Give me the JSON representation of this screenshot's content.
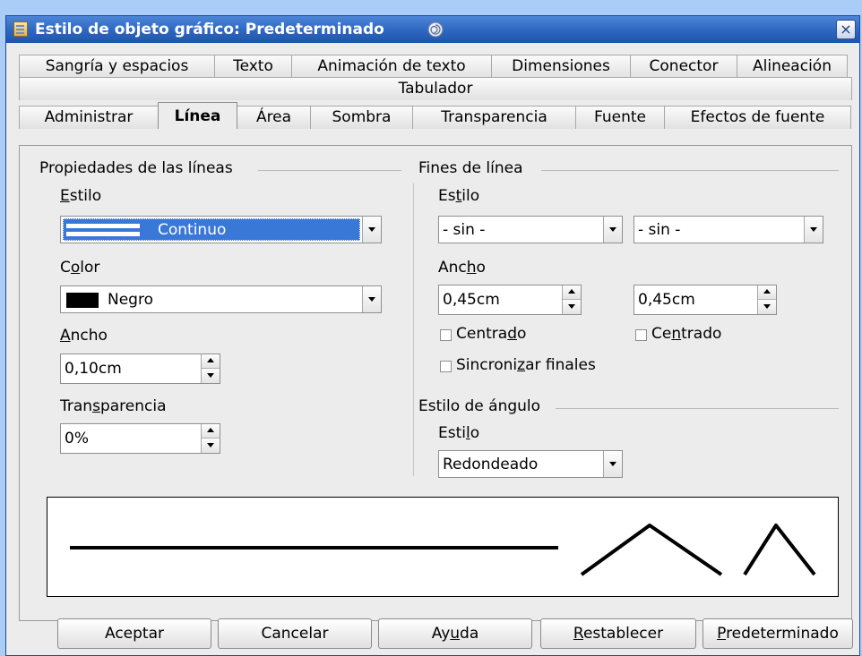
{
  "window": {
    "title": "Estilo de objeto gráfico: Predeterminado",
    "close_glyph": "×"
  },
  "tabs": {
    "row1": [
      "Sangría y espacios",
      "Texto",
      "Animación de texto",
      "Dimensiones",
      "Conector",
      "Alineación"
    ],
    "row2": [
      "Tabulador"
    ],
    "row3": [
      "Administrar",
      "Línea",
      "Área",
      "Sombra",
      "Transparencia",
      "Fuente",
      "Efectos de fuente"
    ],
    "active": "Línea"
  },
  "line_props": {
    "group_title": "Propiedades de las líneas",
    "style_label": {
      "pre": "",
      "u": "E",
      "post": "stilo"
    },
    "style_value": "Continuo",
    "color_label": {
      "pre": "C",
      "u": "o",
      "post": "lor"
    },
    "color_value": "Negro",
    "color_swatch": "#000000",
    "width_label": {
      "pre": "",
      "u": "A",
      "post": "ncho"
    },
    "width_value": "0,10cm",
    "transp_label": {
      "pre": "Tran",
      "u": "s",
      "post": "parencia"
    },
    "transp_value": "0%"
  },
  "line_ends": {
    "group_title": "Fines de línea",
    "style_label": {
      "pre": "Es",
      "u": "t",
      "post": "ilo"
    },
    "start_style": "- sin -",
    "end_style": "- sin -",
    "width_label": {
      "pre": "Anc",
      "u": "h",
      "post": "o"
    },
    "start_width": "0,45cm",
    "end_width": "0,45cm",
    "centered1": {
      "pre": "Centra",
      "u": "d",
      "post": "o"
    },
    "centered2": {
      "pre": "Ce",
      "u": "n",
      "post": "trado"
    },
    "sync": {
      "pre": "Sincroni",
      "u": "z",
      "post": "ar finales"
    }
  },
  "corner": {
    "group_title": "Estilo de ángulo",
    "style_label": {
      "pre": "Esti",
      "u": "l",
      "post": "o"
    },
    "style_value": "Redondeado"
  },
  "buttons": {
    "ok": {
      "pre": "Aceptar",
      "u": "",
      "post": ""
    },
    "cancel": {
      "pre": "Cancelar",
      "u": "",
      "post": ""
    },
    "help": {
      "pre": "Ay",
      "u": "u",
      "post": "da"
    },
    "reset": {
      "pre": "",
      "u": "R",
      "post": "establecer"
    },
    "default": {
      "pre": "",
      "u": "P",
      "post": "redeterminado"
    }
  },
  "colors": {
    "titlebar": "#2d66c0",
    "selection": "#3a78d8",
    "background": "#a9cdf6"
  }
}
